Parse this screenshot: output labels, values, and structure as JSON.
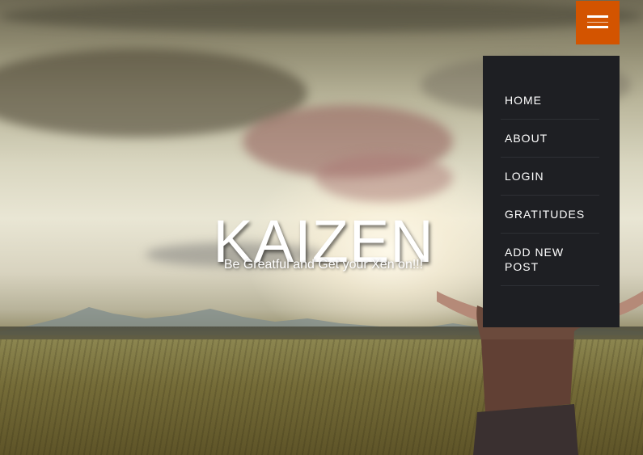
{
  "hero": {
    "title": "KAIZEN",
    "subtitle": "Be Greatful and Get your Xen on!!!"
  },
  "menu_toggle": {
    "icon": "hamburger-icon",
    "color": "#d35400"
  },
  "nav": {
    "background": "#1e1f23",
    "items": [
      {
        "label": "HOME"
      },
      {
        "label": "ABOUT"
      },
      {
        "label": "LOGIN"
      },
      {
        "label": "GRATITUDES"
      },
      {
        "label": "ADD NEW POST"
      }
    ]
  }
}
